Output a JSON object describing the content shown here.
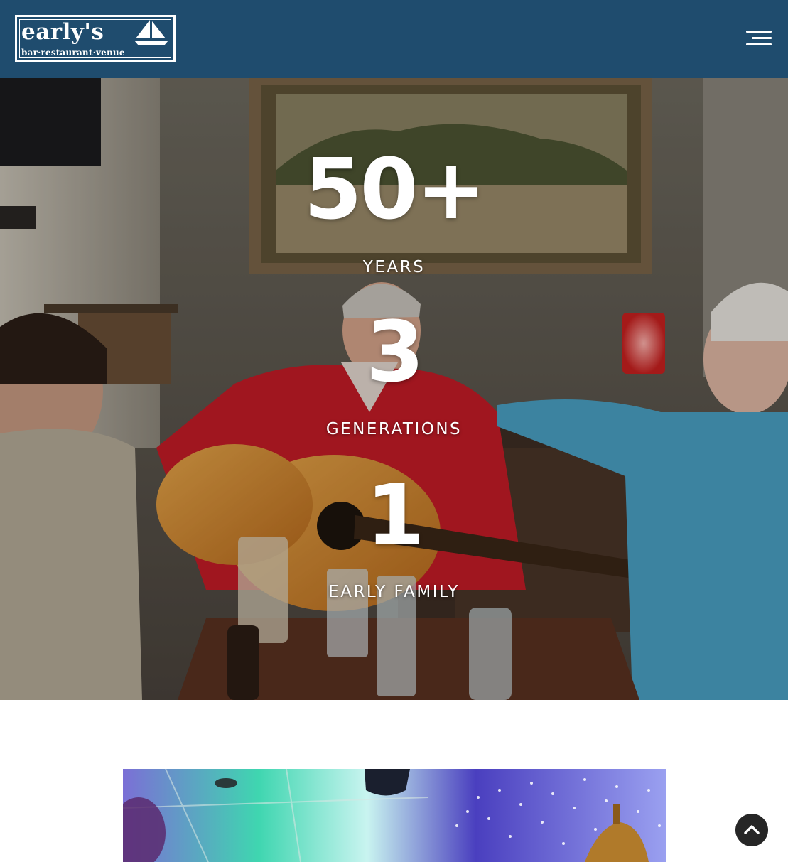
{
  "header": {
    "logo": {
      "name": "early's",
      "tagline": "bar·restaurant·venue"
    },
    "menu_icon": "hamburger-menu-icon",
    "background_color": "#1f4c6e"
  },
  "hero": {
    "stats": [
      {
        "number": "50+",
        "label": "YEARS"
      },
      {
        "number": "3",
        "label": "GENERATIONS"
      },
      {
        "number": "1",
        "label": "EARLY FAMILY"
      }
    ]
  },
  "scroll_top": {
    "icon": "chevron-up-icon",
    "background_color": "#262626"
  }
}
